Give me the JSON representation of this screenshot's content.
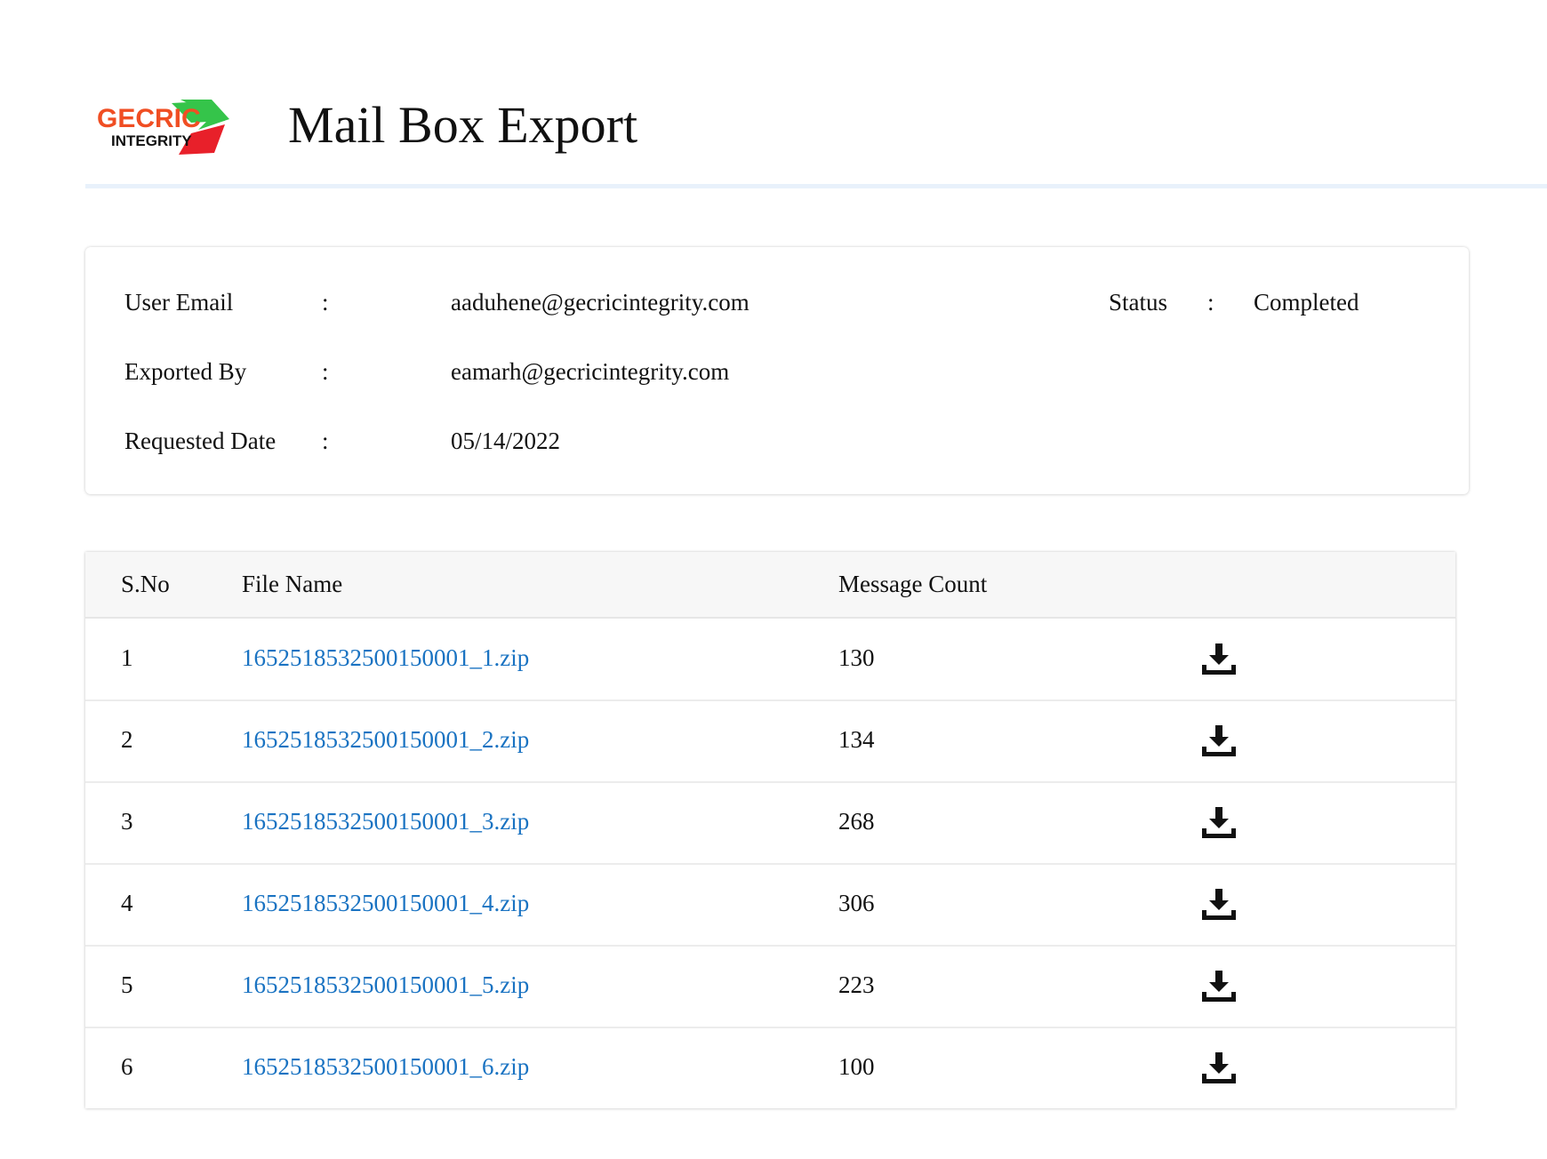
{
  "header": {
    "logo_text_top": "GECRIC",
    "logo_text_bottom": "INTEGRITY",
    "title": "Mail Box Export"
  },
  "colors": {
    "link": "#1a73c2",
    "logo_orange": "#f04e23",
    "logo_green": "#35c44a",
    "logo_red": "#e8202a",
    "header_rule": "#e8f1fb",
    "table_header_bg": "#f7f7f7"
  },
  "info": {
    "user_email_label": "User Email",
    "user_email_value": "aaduhene@gecricintegrity.com",
    "exported_by_label": "Exported By",
    "exported_by_value": "eamarh@gecricintegrity.com",
    "requested_date_label": "Requested Date",
    "requested_date_value": "05/14/2022",
    "status_label": "Status",
    "status_value": "Completed",
    "separator": ":"
  },
  "table": {
    "columns": [
      "S.No",
      "File Name",
      "Message Count",
      ""
    ],
    "rows": [
      {
        "sno": "1",
        "file": "1652518532500150001_1.zip",
        "count": "130",
        "action_icon": "download-icon"
      },
      {
        "sno": "2",
        "file": "1652518532500150001_2.zip",
        "count": "134",
        "action_icon": "download-icon"
      },
      {
        "sno": "3",
        "file": "1652518532500150001_3.zip",
        "count": "268",
        "action_icon": "download-icon"
      },
      {
        "sno": "4",
        "file": "1652518532500150001_4.zip",
        "count": "306",
        "action_icon": "download-icon"
      },
      {
        "sno": "5",
        "file": "1652518532500150001_5.zip",
        "count": "223",
        "action_icon": "download-icon"
      },
      {
        "sno": "6",
        "file": "1652518532500150001_6.zip",
        "count": "100",
        "action_icon": "download-icon"
      }
    ]
  }
}
